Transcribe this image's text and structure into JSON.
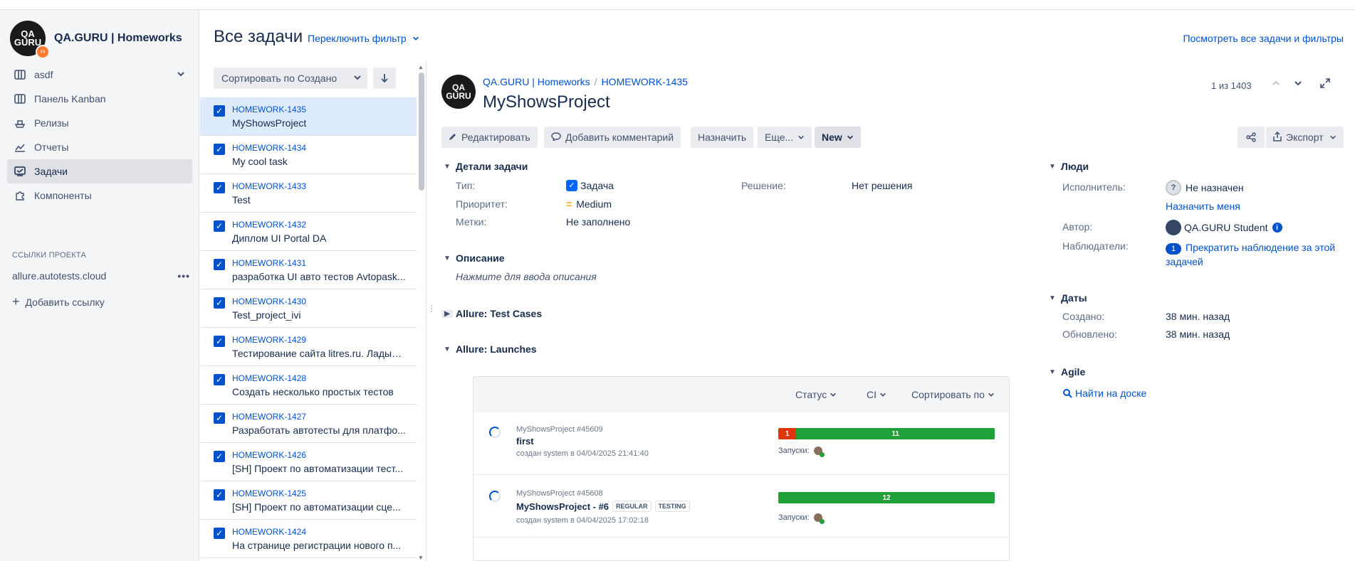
{
  "project": {
    "name": "QA.GURU | Homeworks",
    "logo_text": "QA GURU"
  },
  "sidebar": {
    "board_selector": "asdf",
    "items": [
      {
        "label": "Панель Kanban",
        "icon": "board-icon"
      },
      {
        "label": "Релизы",
        "icon": "ship-icon"
      },
      {
        "label": "Отчеты",
        "icon": "chart-icon"
      },
      {
        "label": "Задачи",
        "icon": "issues-icon",
        "active": true
      },
      {
        "label": "Компоненты",
        "icon": "puzzle-icon"
      }
    ],
    "section_title": "ССЫЛКИ ПРОЕКТА",
    "project_link": "allure.autotests.cloud",
    "add_link": "Добавить ссылку"
  },
  "header": {
    "title": "Все задачи",
    "switch_filter": "Переключить фильтр",
    "view_all": "Посмотреть все задачи и фильтры"
  },
  "list": {
    "sort_label": "Сортировать по Создано",
    "issues": [
      {
        "key": "HOMEWORK-1435",
        "summary": "MyShowsProject"
      },
      {
        "key": "HOMEWORK-1434",
        "summary": "My cool task"
      },
      {
        "key": "HOMEWORK-1433",
        "summary": "Test"
      },
      {
        "key": "HOMEWORK-1432",
        "summary": "Диплом UI Portal DA"
      },
      {
        "key": "HOMEWORK-1431",
        "summary": "разработка UI авто тестов Avtopask..."
      },
      {
        "key": "HOMEWORK-1430",
        "summary": "Test_project_ivi"
      },
      {
        "key": "HOMEWORK-1429",
        "summary": "Тестирование сайта litres.ru. Ладыж..."
      },
      {
        "key": "HOMEWORK-1428",
        "summary": "Создать несколько простых тестов"
      },
      {
        "key": "HOMEWORK-1427",
        "summary": "Разработать автотесты для платфо..."
      },
      {
        "key": "HOMEWORK-1426",
        "summary": "[SH] Проект по автоматизации тест..."
      },
      {
        "key": "HOMEWORK-1425",
        "summary": "[SH] Проект по автоматизации сце..."
      },
      {
        "key": "HOMEWORK-1424",
        "summary": "На странице регистрации нового п..."
      }
    ]
  },
  "issue": {
    "breadcrumb_project": "QA.GURU | Homeworks",
    "breadcrumb_key": "HOMEWORK-1435",
    "title": "MyShowsProject",
    "pager": "1 из 1403",
    "buttons": {
      "edit": "Редактировать",
      "comment": "Добавить комментарий",
      "assign": "Назначить",
      "more": "Еще...",
      "status": "New",
      "export": "Экспорт"
    },
    "details": {
      "title": "Детали задачи",
      "type_label": "Тип:",
      "type_value": "Задача",
      "priority_label": "Приоритет:",
      "priority_value": "Medium",
      "labels_label": "Метки:",
      "labels_value": "Не заполнено",
      "resolution_label": "Решение:",
      "resolution_value": "Нет решения"
    },
    "description": {
      "title": "Описание",
      "placeholder": "Нажмите для ввода описания"
    },
    "allure_cases": "Allure: Test Cases",
    "allure_launches": "Allure: Launches",
    "launch_filters": {
      "status": "Статус",
      "ci": "CI",
      "sort": "Сортировать по"
    },
    "launches": [
      {
        "name": "MyShowsProject #45609",
        "title": "first",
        "tags": [],
        "meta": "создан system в 04/04/2025 21:41:40",
        "failed": 1,
        "passed": 11,
        "runs_label": "Запуски:"
      },
      {
        "name": "MyShowsProject #45608",
        "title": "MyShowsProject - #6",
        "tags": [
          "REGULAR",
          "TESTING"
        ],
        "meta": "создан system в 04/04/2025 17:02:18",
        "failed": 0,
        "passed": 12,
        "runs_label": "Запуски:"
      }
    ],
    "people": {
      "title": "Люди",
      "assignee_label": "Исполнитель:",
      "assignee_value": "Не назначен",
      "assign_me": "Назначить меня",
      "reporter_label": "Автор:",
      "reporter_value": "QA.GURU Student",
      "watchers_label": "Наблюдатели:",
      "watchers_count": "1",
      "watch_action": "Прекратить наблюдение за этой задачей"
    },
    "dates": {
      "title": "Даты",
      "created_label": "Создано:",
      "created_value": "38 мин. назад",
      "updated_label": "Обновлено:",
      "updated_value": "38 мин. назад"
    },
    "agile": {
      "title": "Agile",
      "find_on_board": "Найти на доске"
    }
  },
  "colors": {
    "link": "#0052cc",
    "failed": "#de350b",
    "passed": "#1fa038",
    "selected_row": "#deebff"
  }
}
